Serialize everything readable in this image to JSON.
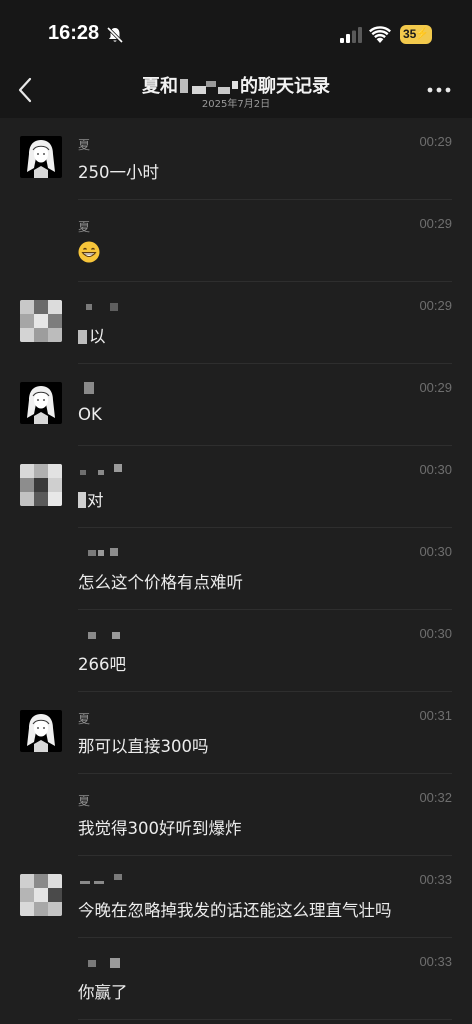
{
  "status_bar": {
    "time": "16:28",
    "battery": "35",
    "icons": [
      "bell-off-icon",
      "signal-icon",
      "wifi-icon",
      "battery-icon"
    ]
  },
  "nav": {
    "title_prefix": "夏和",
    "title_suffix": "的聊天记录",
    "subtitle": "2025年7月2日",
    "icons": [
      "back-icon",
      "more-icon"
    ]
  },
  "messages": [
    {
      "sender": "夏",
      "time": "00:29",
      "text": "250一小时",
      "avatar": "girl"
    },
    {
      "sender": "夏",
      "time": "00:29",
      "text": "",
      "emoji": "grinning-face",
      "avatar": "none"
    },
    {
      "sender": "",
      "time": "00:29",
      "text": "以",
      "avatar": "pixel"
    },
    {
      "sender": "",
      "time": "00:29",
      "text": "OK",
      "avatar": "girl"
    },
    {
      "sender": "",
      "time": "00:30",
      "text": "对",
      "avatar": "pixel"
    },
    {
      "sender": "",
      "time": "00:30",
      "text": "怎么这个价格有点难听",
      "avatar": "none"
    },
    {
      "sender": "",
      "time": "00:30",
      "text": "266吧",
      "avatar": "none"
    },
    {
      "sender": "夏",
      "time": "00:31",
      "text": "那可以直接300吗",
      "avatar": "girl"
    },
    {
      "sender": "夏",
      "time": "00:32",
      "text": "我觉得300好听到爆炸",
      "avatar": "none"
    },
    {
      "sender": "",
      "time": "00:33",
      "text": "今晚在忽略掉我发的话还能这么理直气壮吗",
      "avatar": "pixel"
    },
    {
      "sender": "",
      "time": "00:33",
      "text": "你赢了",
      "avatar": "none"
    }
  ]
}
